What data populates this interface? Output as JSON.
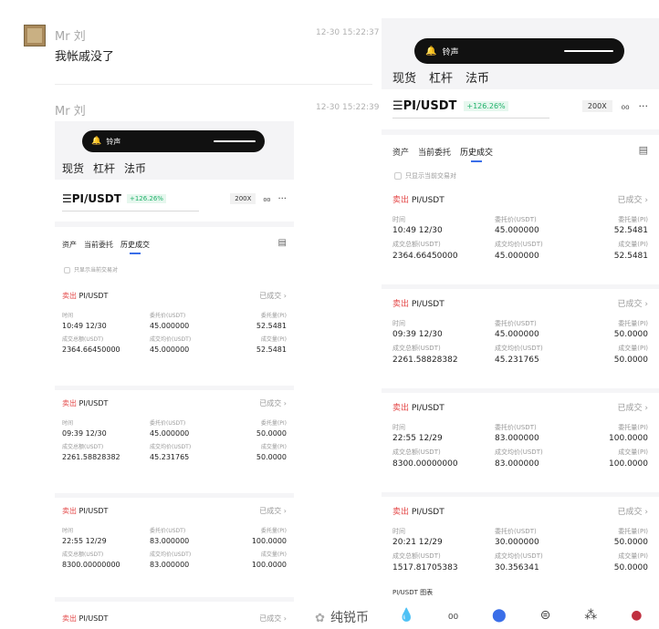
{
  "chat": {
    "messages": [
      {
        "sender": "Mr 刘",
        "time": "12-30 15:22:37",
        "text": "我帐戚没了"
      },
      {
        "sender": "Mr 刘",
        "time": "12-30 15:22:39"
      }
    ],
    "watermark": "纯锐币"
  },
  "app": {
    "notification": "铃声",
    "market_tabs": [
      "现货",
      "杠杆",
      "法币"
    ],
    "pair": "PI/USDT",
    "change": "+126.26%",
    "leverage": "200X",
    "sub_tabs": [
      "资产",
      "当前委托",
      "历史成交"
    ],
    "filter_label": "只显示当前交易对",
    "status_label": "已成交",
    "side_label": "卖出",
    "col_labels": {
      "time": "时间",
      "price": "委托价(USDT)",
      "amount": "委托量(PI)",
      "total": "成交总额(USDT)",
      "avg": "成交均价(USDT)",
      "filled": "成交量(PI)"
    },
    "orders": [
      {
        "pair": "PI/USDT",
        "time": "10:49 12/30",
        "price": "45.000000",
        "amount": "52.5481",
        "total": "2364.66450000",
        "avg": "45.000000",
        "filled": "52.5481"
      },
      {
        "pair": "PI/USDT",
        "time": "09:39 12/30",
        "price": "45.000000",
        "amount": "50.0000",
        "total": "2261.58828382",
        "avg": "45.231765",
        "filled": "50.0000"
      },
      {
        "pair": "PI/USDT",
        "time": "22:55 12/29",
        "price": "83.000000",
        "amount": "100.0000",
        "total": "8300.00000000",
        "avg": "83.000000",
        "filled": "100.0000"
      },
      {
        "pair": "PI/USDT",
        "time": "20:21 12/29",
        "price": "30.000000",
        "amount": "50.0000",
        "total": "1517.81705383",
        "avg": "30.356341",
        "filled": "50.0000"
      }
    ],
    "chart_label": "PI/USDT 图表"
  }
}
